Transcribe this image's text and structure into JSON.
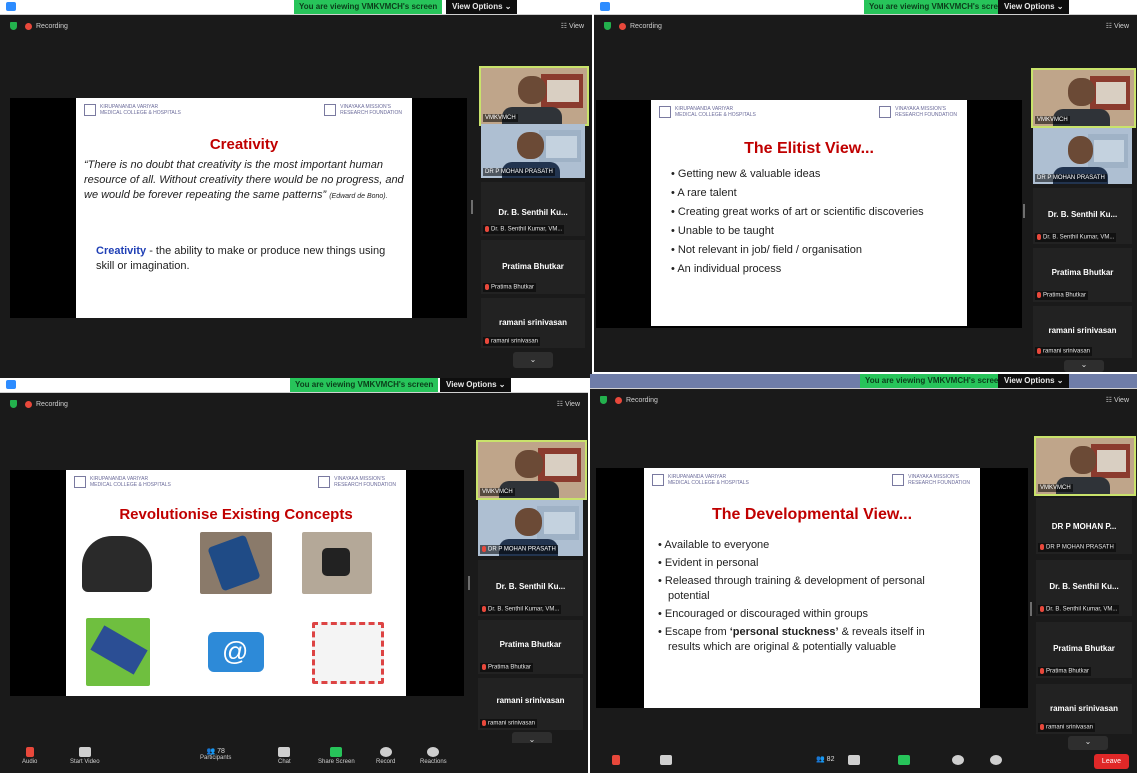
{
  "banner": "You are viewing VMKVMCH's screen",
  "view_options": "View Options ⌄",
  "recording": "Recording",
  "view": "View",
  "q1": {
    "slide_title": "Creativity",
    "quote": "“There is no doubt that creativity is the most important human resource of all. Without creativity there would be no progress, and we would be forever repeating the same patterns”",
    "quote_author": "(Edward de Bono).",
    "def_term": "Creativity",
    "def_text": " - the ability to make or produce new things using skill or imagination.",
    "video_1": "VMKVMCH",
    "video_2": "DR P MOHAN PRASATH",
    "tiles": [
      {
        "name": "Dr. B. Senthil Ku...",
        "sub": "Dr. B. Senthil Kumar, VM..."
      },
      {
        "name": "Pratima Bhutkar",
        "sub": "Pratima Bhutkar"
      },
      {
        "name": "ramani srinivasan",
        "sub": "ramani srinivasan"
      }
    ]
  },
  "q2": {
    "slide_title": "The Elitist View...",
    "bullets": [
      "Getting new & valuable ideas",
      "A rare talent",
      "Creating great works of art or scientific discoveries",
      "Unable to be taught",
      "Not relevant in job/ field / organisation",
      "An individual process"
    ],
    "video_1": "VMKVMCH",
    "video_2": "DR P MOHAN PRASATH",
    "tiles": [
      {
        "name": "Dr. B. Senthil Ku...",
        "sub": "Dr. B. Senthil Kumar, VM..."
      },
      {
        "name": "Pratima Bhutkar",
        "sub": "Pratima Bhutkar"
      },
      {
        "name": "ramani srinivasan",
        "sub": "ramani srinivasan"
      }
    ]
  },
  "q3": {
    "slide_title": "Revolutionise Existing Concepts",
    "video_1": "VMKVMCH",
    "video_2": "DR P MOHAN PRASATH",
    "tiles": [
      {
        "name": "Dr. B. Senthil Ku...",
        "sub": "Dr. B. Senthil Kumar, VM..."
      },
      {
        "name": "Pratima Bhutkar",
        "sub": "Pratima Bhutkar"
      },
      {
        "name": "ramani srinivasan",
        "sub": "ramani srinivasan"
      }
    ],
    "participants_count": "78",
    "toolbar": [
      "Audio",
      "Start Video",
      "Participants",
      "Chat",
      "Share Screen",
      "Record",
      "Reactions"
    ]
  },
  "q4": {
    "slide_title": "The Developmental View...",
    "bullets": [
      "Available to everyone",
      "Evident in personal",
      "Released through training & development of personal potential",
      "Encouraged or discouraged within groups"
    ],
    "last_pre": "Escape from ",
    "last_bold": "‘personal stuckness’",
    "last_post": " & reveals itself in results which are original & potentially valuable",
    "video_1": "VMKVMCH",
    "tiles": [
      {
        "name": "DR P MOHAN P...",
        "sub": "DR P MOHAN PRASATH"
      },
      {
        "name": "Dr. B. Senthil Ku...",
        "sub": "Dr. B. Senthil Kumar, VM..."
      },
      {
        "name": "Pratima Bhutkar",
        "sub": "Pratima Bhutkar"
      },
      {
        "name": "ramani srinivasan",
        "sub": "ramani srinivasan"
      }
    ],
    "participants_count": "82",
    "leave": "Leave"
  },
  "logos": {
    "left_line1": "KIRUPANANDA VARIYAR",
    "left_line2": "MEDICAL COLLEGE & HOSPITALS",
    "right_line1": "VINAYAKA MISSION'S",
    "right_line2": "RESEARCH FOUNDATION"
  },
  "colors": {
    "accent_green": "#27c45a",
    "title_red": "#c00000",
    "leave_red": "#e02828",
    "speaker_border": "#c9e36b"
  }
}
